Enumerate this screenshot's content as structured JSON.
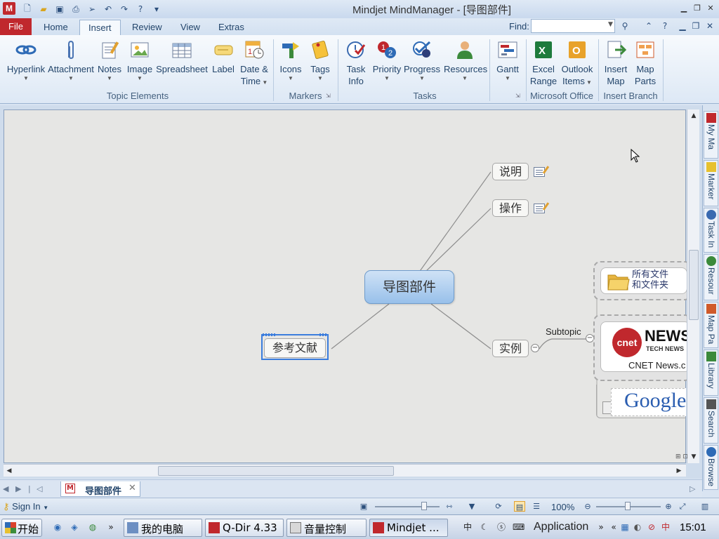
{
  "window": {
    "title": "Mindjet MindManager - [导图部件]"
  },
  "quick_access": {
    "icons": [
      "new-doc-icon",
      "open-folder-icon",
      "save-icon",
      "print-icon",
      "send-icon",
      "undo-icon",
      "redo-icon",
      "help-icon",
      "customize-icon"
    ]
  },
  "ribbon_tabs": {
    "file": "File",
    "tabs": [
      "Home",
      "Insert",
      "Review",
      "View",
      "Extras"
    ],
    "active": "Insert",
    "find_label": "Find:",
    "find_value": ""
  },
  "ribbon": {
    "groups": {
      "topic_elements": "Topic Elements",
      "markers": "Markers",
      "tasks": "Tasks",
      "microsoft_office": "Microsoft Office",
      "insert_branch": "Insert Branch"
    },
    "buttons": {
      "hyperlink": "Hyperlink",
      "attachment": "Attachment",
      "notes": "Notes",
      "image": "Image",
      "spreadsheet": "Spreadsheet",
      "label": "Label",
      "date_time_1": "Date &",
      "date_time_2": "Time",
      "icons": "Icons",
      "tags": "Tags",
      "task_info_1": "Task",
      "task_info_2": "Info",
      "priority": "Priority",
      "progress": "Progress",
      "resources": "Resources",
      "gantt": "Gantt",
      "excel_range_1": "Excel",
      "excel_range_2": "Range",
      "outlook_items_1": "Outlook",
      "outlook_items_2": "Items",
      "insert_map_1": "Insert",
      "insert_map_2": "Map",
      "map_parts_1": "Map",
      "map_parts_2": "Parts"
    }
  },
  "mindmap": {
    "central": "导图部件",
    "topics": {
      "shuoming": "说明",
      "caozuo": "操作",
      "shili": "实例",
      "cankao": "参考文献"
    },
    "subtopic_label": "Subtopic",
    "image_items": {
      "folder_line1": "所有文件",
      "folder_line2": "和文件夹",
      "cnet_logo": "cnet",
      "cnet_news": "NEWS",
      "cnet_technews": "TECH NEWS",
      "cnet_caption": "CNET News.c",
      "google": "Google"
    }
  },
  "side_panel": {
    "tabs": [
      "My Ma",
      "Marker",
      "Task In",
      "Resour",
      "Map Pa",
      "Library",
      "Search",
      "Browse"
    ]
  },
  "doc_tab": {
    "label": "导图部件"
  },
  "status": {
    "sign_in": "Sign In",
    "zoom": "100%"
  },
  "taskbar": {
    "start": "开始",
    "items": [
      "我的电脑",
      "Q-Dir 4.33",
      "音量控制",
      "Mindjet ..."
    ],
    "application": "Application",
    "clock": "15:01"
  },
  "colors": {
    "accent_red": "#c0282d",
    "central_topic": "#98c0ea",
    "ribbon_text": "#23456b"
  }
}
